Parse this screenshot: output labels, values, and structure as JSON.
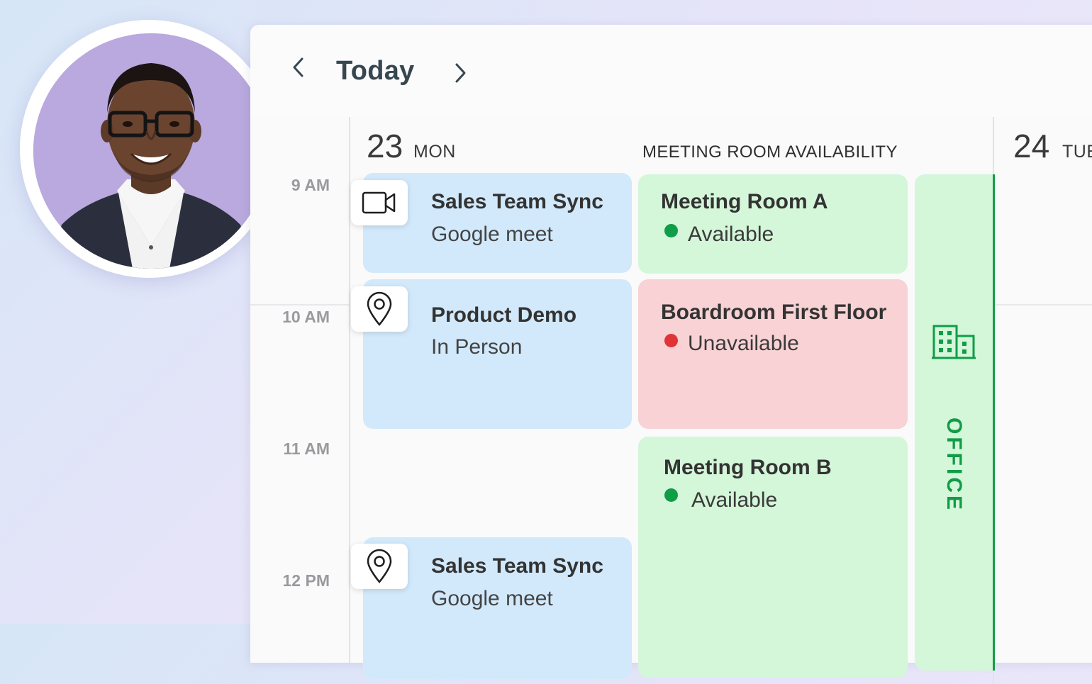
{
  "nav": {
    "prev_icon": "chevron-left-icon",
    "next_icon": "chevron-right-icon",
    "today_label": "Today"
  },
  "time_axis": [
    "9 AM",
    "10 AM",
    "11 AM",
    "12 PM"
  ],
  "days": [
    {
      "number": "23",
      "name": "MON"
    },
    {
      "number": "24",
      "name": "TUE"
    }
  ],
  "meeting_room_section": {
    "title": "MEETING ROOM AVAILABILITY"
  },
  "events": [
    {
      "title": "Sales Team Sync",
      "subtitle": "Google meet",
      "icon": "video-camera-icon"
    },
    {
      "title": "Product Demo",
      "subtitle": "In Person",
      "icon": "location-pin-icon"
    },
    {
      "title": "Sales Team Sync",
      "subtitle": "Google meet",
      "icon": "location-pin-icon"
    }
  ],
  "rooms": [
    {
      "name": "Meeting Room A",
      "status": "Available",
      "status_color": "#0f9d48"
    },
    {
      "name": "Boardroom First Floor",
      "status": "Unavailable",
      "status_color": "#e03438"
    },
    {
      "name": "Meeting Room B",
      "status": "Available",
      "status_color": "#0f9d48"
    }
  ],
  "office": {
    "label": "OFFICE",
    "icon": "office-building-icon",
    "color": "#0f9d48"
  },
  "colors": {
    "event_bg": "#d2e9fb",
    "available_bg": "#d4f6d9",
    "unavailable_bg": "#f8d2d4",
    "avatar_bg": "#b7a8dd"
  },
  "avatar": {
    "icon": "user-avatar-photo"
  }
}
